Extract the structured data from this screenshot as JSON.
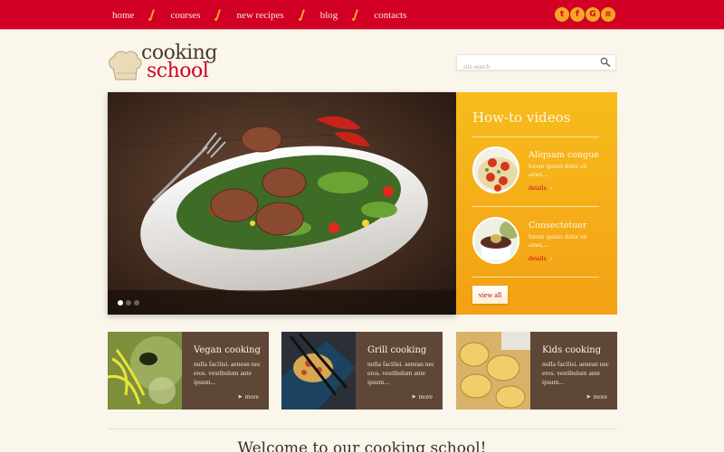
{
  "nav": {
    "items": [
      "home",
      "courses",
      "new recipes",
      "blog",
      "contacts"
    ]
  },
  "social": [
    {
      "icon": "twitter-icon",
      "glyph": "t"
    },
    {
      "icon": "facebook-icon",
      "glyph": "f"
    },
    {
      "icon": "google-icon",
      "glyph": "G"
    },
    {
      "icon": "rss-icon",
      "glyph": "≋"
    }
  ],
  "logo": {
    "line1": "cooking",
    "line2": "school"
  },
  "search": {
    "placeholder": "site search",
    "value": ""
  },
  "slider": {
    "slide_count": 3,
    "active_slide": 1
  },
  "howto": {
    "title": "How-to videos",
    "videos": [
      {
        "title": "Aliquam congue",
        "desc": "lorem ipsum dolor sit amet,...",
        "link": "details",
        "chevron": "›"
      },
      {
        "title": "Consectetuer",
        "desc": "lorem ipsum dolor sit amet,...",
        "link": "details",
        "chevron": "›"
      }
    ],
    "view_all": "view all"
  },
  "cards": [
    {
      "title": "Vegan cooking",
      "desc": "nulla facilisi. aenean nec eros. vestibulum ante ipsum...",
      "more": "more",
      "tri": "▶"
    },
    {
      "title": "Grill cooking",
      "desc": "nulla facilisi. aenean nec eros. vestibulum ante ipsum...",
      "more": "more",
      "tri": "▶"
    },
    {
      "title": "Kids cooking",
      "desc": "nulla facilisi. aenean nec eros. vestibulum ante ipsum...",
      "more": "more",
      "tri": "▶"
    }
  ],
  "welcome": {
    "title": "Welcome to our cooking school!"
  },
  "colors": {
    "brand_red": "#d10024",
    "accent_orange": "#f5a623",
    "card_brown": "#5f4738",
    "page_bg": "#fbf6ec"
  }
}
